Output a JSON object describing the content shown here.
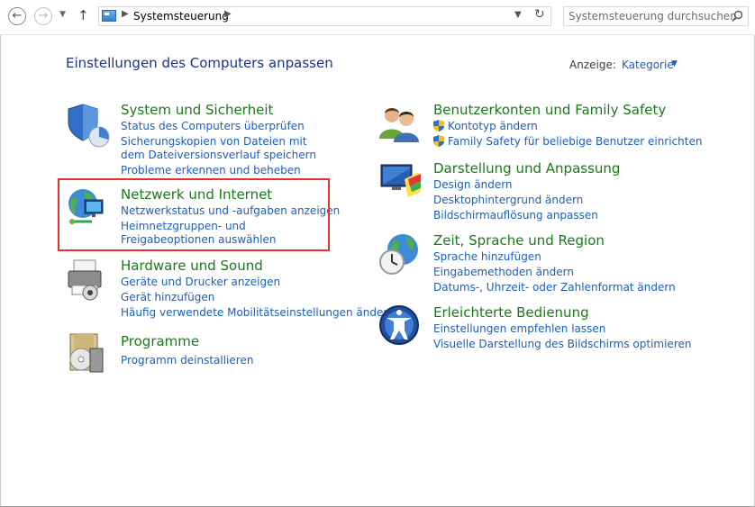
{
  "nav": {
    "back_glyph": "←",
    "forward_glyph": "→",
    "up_glyph": "↑",
    "address": "Systemsteuerung",
    "search_placeholder": "Systemsteuerung durchsuchen"
  },
  "page": {
    "title": "Einstellungen des Computers anpassen",
    "view_by_label": "Anzeige:",
    "view_by_value": "Kategorie"
  },
  "categories": [
    {
      "name": "System und Sicherheit",
      "icon": "security-shield-icon",
      "links": [
        "Status des Computers überprüfen",
        "Sicherungskopien von Dateien mit dem Dateiversionsverlauf speichern",
        "Probleme erkennen und beheben"
      ]
    },
    {
      "name": "Netzwerk und Internet",
      "icon": "network-globe-icon",
      "links": [
        "Netzwerkstatus und -aufgaben anzeigen",
        "Heimnetzgruppen- und Freigabeoptionen auswählen"
      ]
    },
    {
      "name": "Hardware und Sound",
      "icon": "printer-icon",
      "links": [
        "Geräte und Drucker anzeigen",
        "Gerät hinzufügen",
        "Häufig verwendete Mobilitätseinstellungen ändern"
      ]
    },
    {
      "name": "Programme",
      "icon": "programs-disc-icon",
      "links": [
        "Programm deinstallieren"
      ]
    },
    {
      "name": "Benutzerkonten und Family Safety",
      "icon": "users-icon",
      "links": [
        "Kontotyp ändern",
        "Family Safety für beliebige Benutzer einrichten"
      ]
    },
    {
      "name": "Darstellung und Anpassung",
      "icon": "display-palette-icon",
      "links": [
        "Design ändern",
        "Desktophintergrund ändern",
        "Bildschirmauflösung anpassen"
      ]
    },
    {
      "name": "Zeit, Sprache und Region",
      "icon": "clock-globe-icon",
      "links": [
        "Sprache hinzufügen",
        "Eingabemethoden ändern",
        "Datums-, Uhrzeit- oder Zahlenformat ändern"
      ]
    },
    {
      "name": "Erleichterte Bedienung",
      "icon": "accessibility-icon",
      "links": [
        "Einstellungen empfehlen lassen",
        "Visuelle Darstellung des Bildschirms optimieren"
      ]
    }
  ],
  "highlight_color": "#e5312d",
  "link_color": "#1c5fb8",
  "category_title_color": "#1a7a1a"
}
